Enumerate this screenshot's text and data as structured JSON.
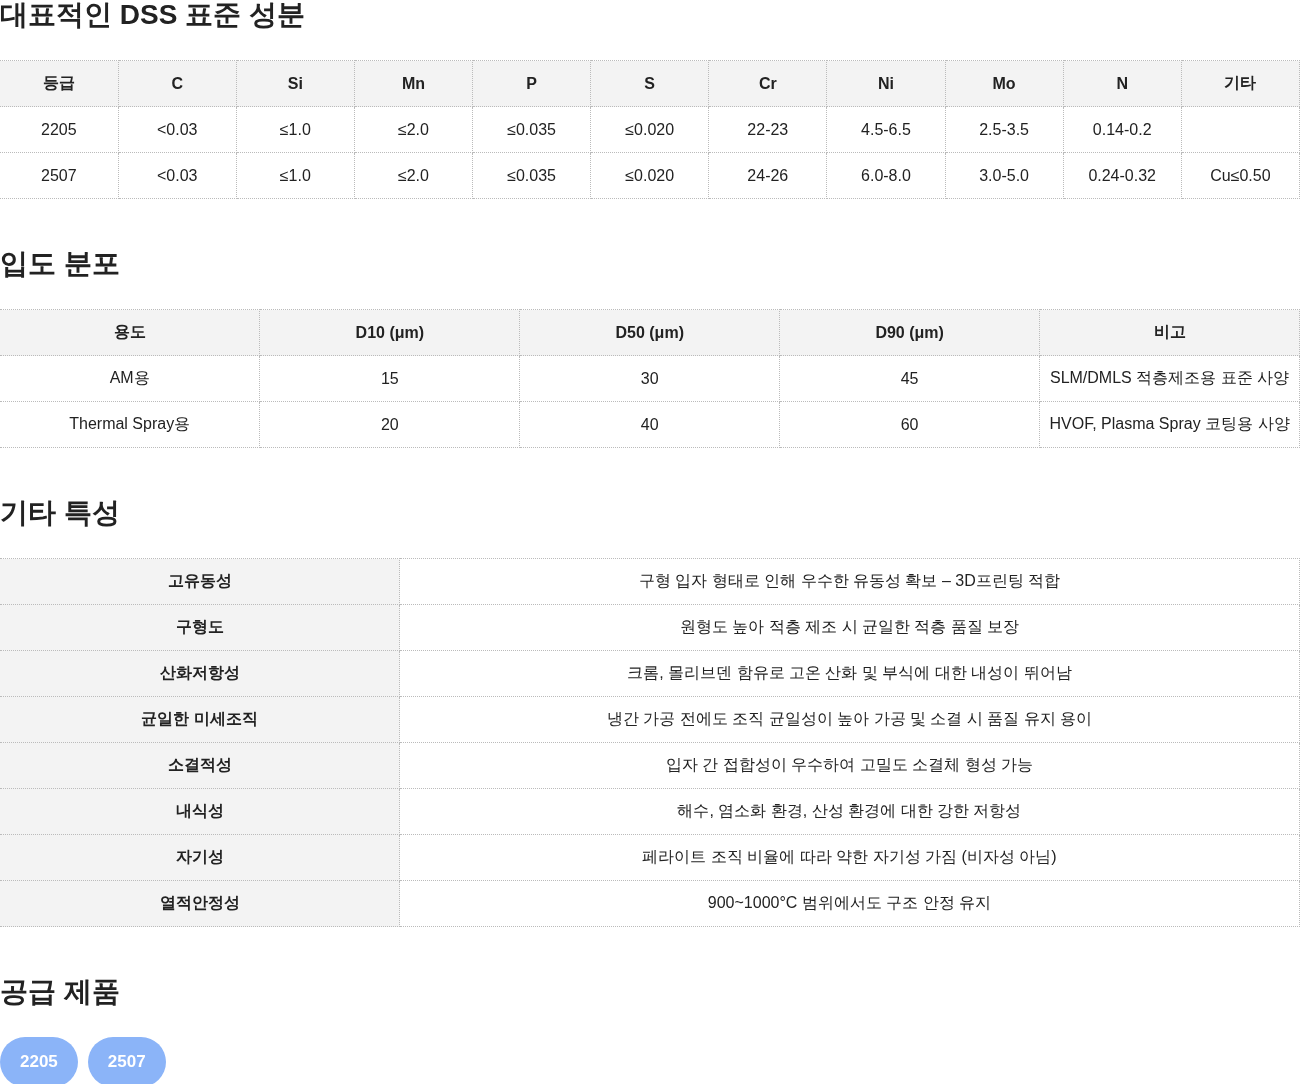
{
  "sections": [
    {
      "kind": "table",
      "title": "대표적인 DSS 표준 성분",
      "columns": [
        "등급",
        "C",
        "Si",
        "Mn",
        "P",
        "S",
        "Cr",
        "Ni",
        "Mo",
        "N",
        "기타"
      ],
      "rows": [
        [
          "2205",
          "<0.03",
          "≤1.0",
          "≤2.0",
          "≤0.035",
          "≤0.020",
          "22-23",
          "4.5-6.5",
          "2.5-3.5",
          "0.14-0.2"
        ],
        [
          "2507",
          "<0.03",
          "≤1.0",
          "≤2.0",
          "≤0.035",
          "≤0.020",
          "24-26",
          "6.0-8.0",
          "3.0-5.0",
          "0.24-0.32",
          "Cu≤0.50"
        ]
      ]
    },
    {
      "kind": "table",
      "title": "입도 분포",
      "columns": [
        "용도",
        "D10 (μm)",
        "D50 (μm)",
        "D90 (μm)",
        "비고"
      ],
      "rows": [
        [
          "AM용",
          "15",
          "30",
          "45",
          "SLM/DMLS 적층제조용 표준 사양"
        ],
        [
          "Thermal Spray용",
          "20",
          "40",
          "60",
          "HVOF, Plasma Spray 코팅용 사양"
        ]
      ]
    },
    {
      "kind": "properties",
      "title": "기타 특성",
      "rows": [
        {
          "name": "고유동성",
          "value": "구형 입자 형태로 인해 우수한 유동성 확보 – 3D프린팅 적합"
        },
        {
          "name": "구형도",
          "value": "원형도 높아 적층 제조 시 균일한 적층 품질 보장"
        },
        {
          "name": "산화저항성",
          "value": "크롬, 몰리브덴 함유로 고온 산화 및 부식에 대한 내성이 뛰어남"
        },
        {
          "name": "균일한 미세조직",
          "value": "냉간 가공 전에도 조직 균일성이 높아 가공 및 소결 시 품질 유지 용이"
        },
        {
          "name": "소결적성",
          "value": "입자 간 접합성이 우수하여 고밀도 소결체 형성 가능"
        },
        {
          "name": "내식성",
          "value": "해수, 염소화 환경, 산성 환경에 대한 강한 저항성"
        },
        {
          "name": "자기성",
          "value": "페라이트 조직 비율에 따라 약한 자기성 가짐 (비자성 아님)"
        },
        {
          "name": "열적안정성",
          "value": "900~1000°C 범위에서도 구조 안정 유지"
        }
      ]
    },
    {
      "kind": "tags",
      "title": "공급 제품",
      "tags": [
        "2205",
        "2507"
      ]
    }
  ]
}
